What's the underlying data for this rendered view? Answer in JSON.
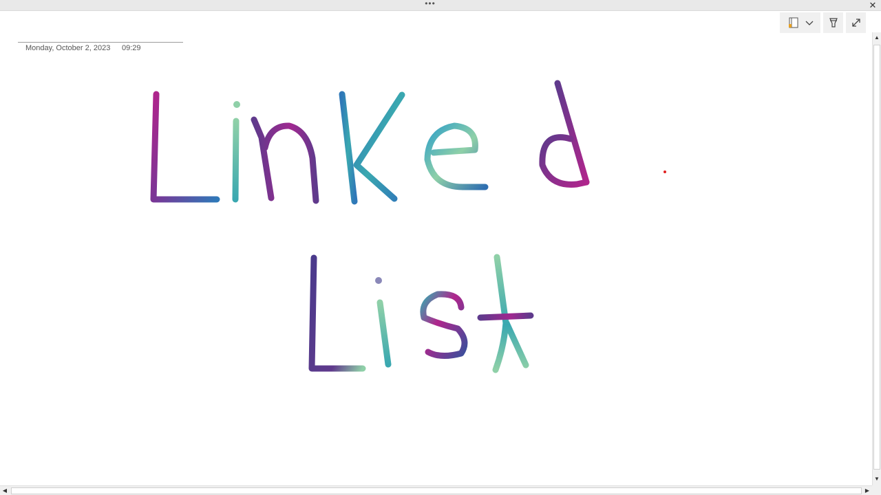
{
  "window": {
    "grip_glyph": "•••",
    "close_glyph": "✕"
  },
  "toolbar": {
    "notebook_icon": "notebook-icon",
    "dropdown_icon": "chevron-down-icon",
    "pen_icon": "pen-icon",
    "fullscreen_icon": "expand-icon"
  },
  "page": {
    "date": "Monday, October 2, 2023",
    "time": "09:29",
    "handwriting_line1": "LinKed",
    "handwriting_line2": "List"
  },
  "colors": {
    "magenta": "#b0258c",
    "purple": "#5f3a8c",
    "blue": "#2f78b8",
    "teal": "#3aa8b0",
    "mint": "#8fd0a8",
    "red_dot": "#e02020"
  }
}
